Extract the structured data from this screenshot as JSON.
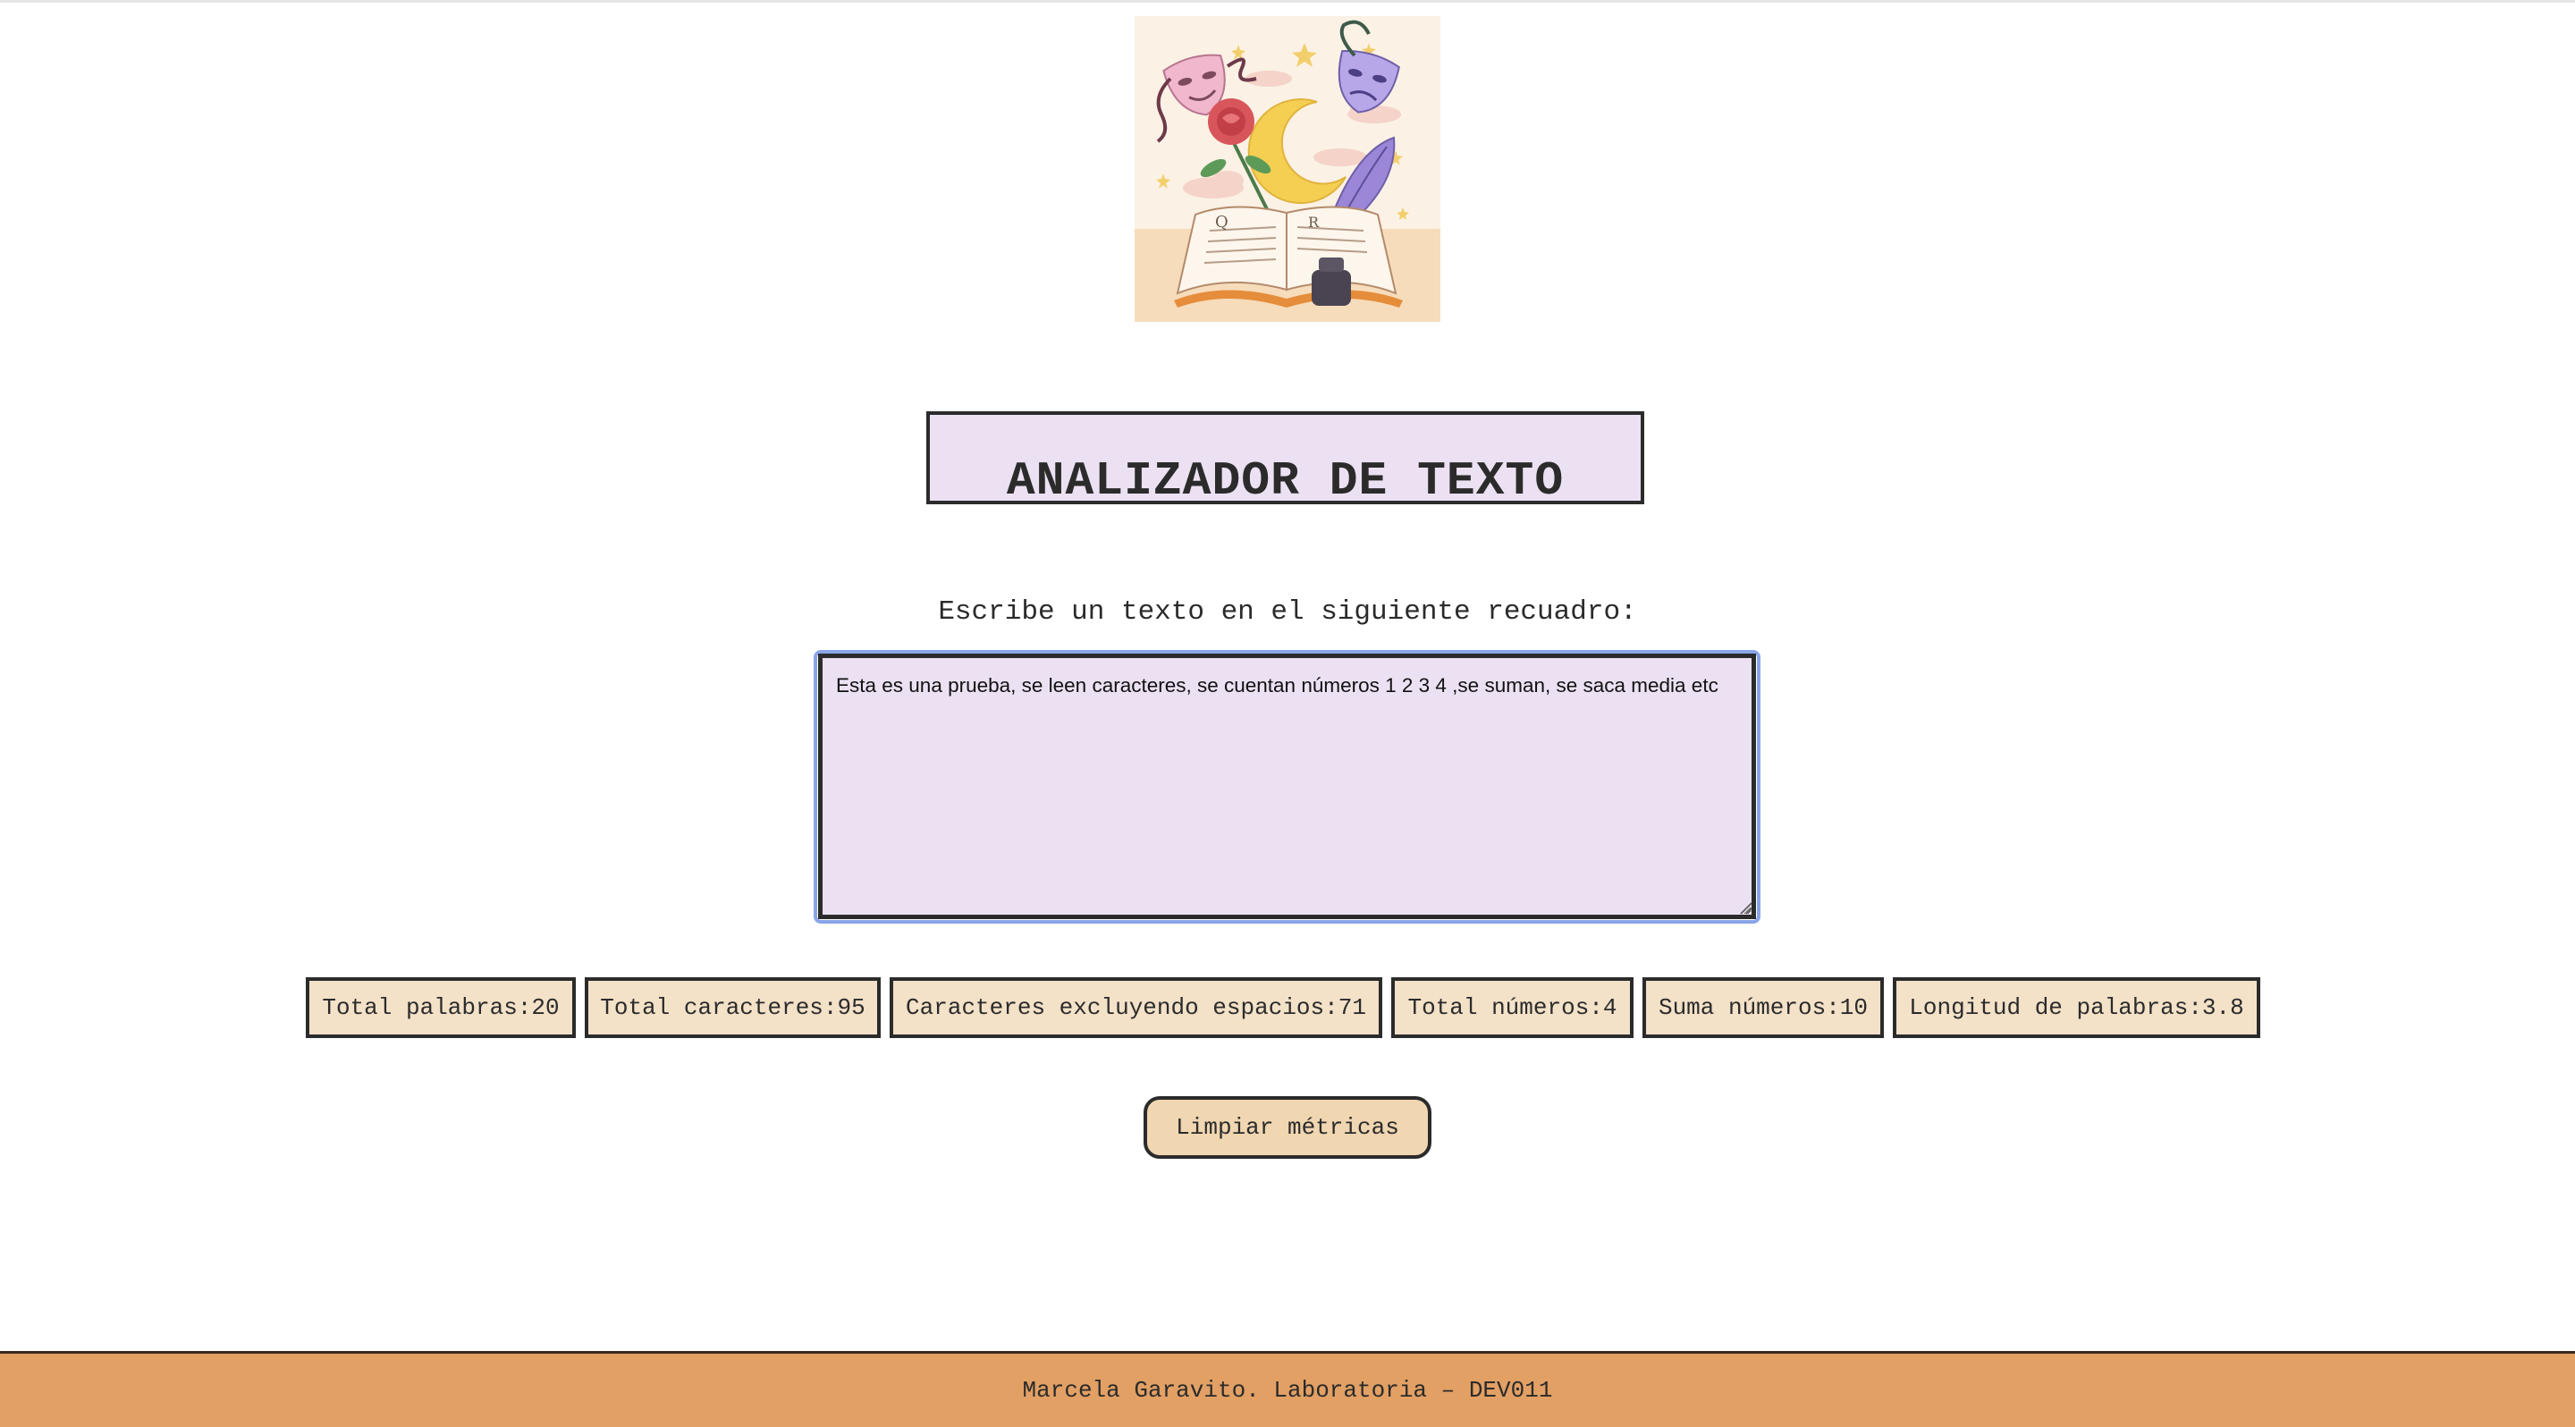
{
  "header": {
    "logo_alt": "Ilustración de libro abierto con máscaras de teatro, luna, rosa y pluma"
  },
  "title": "ANALIZADOR DE TEXTO",
  "prompt": "Escribe un texto en el siguiente recuadro:",
  "text_input": {
    "value": "Esta es una prueba, se leen caracteres, se cuentan números 1 2 3 4 ,se suman, se saca media etc",
    "placeholder": ""
  },
  "metrics": [
    {
      "label": "Total palabras:20"
    },
    {
      "label": "Total caracteres:95"
    },
    {
      "label": "Caracteres excluyendo espacios:71"
    },
    {
      "label": "Total números:4"
    },
    {
      "label": "Suma números:10"
    },
    {
      "label": "Longitud de palabras:3.8"
    }
  ],
  "clear_button": "Limpiar métricas",
  "footer": "Marcela Garavito. Laboratoria – DEV011",
  "colors": {
    "lavender": "#ece1f3",
    "beige": "#f3e1c8",
    "button": "#f0d6b1",
    "footer": "#e2a064",
    "border": "#2b2b2b",
    "focus_ring": "#8aa5e8"
  }
}
